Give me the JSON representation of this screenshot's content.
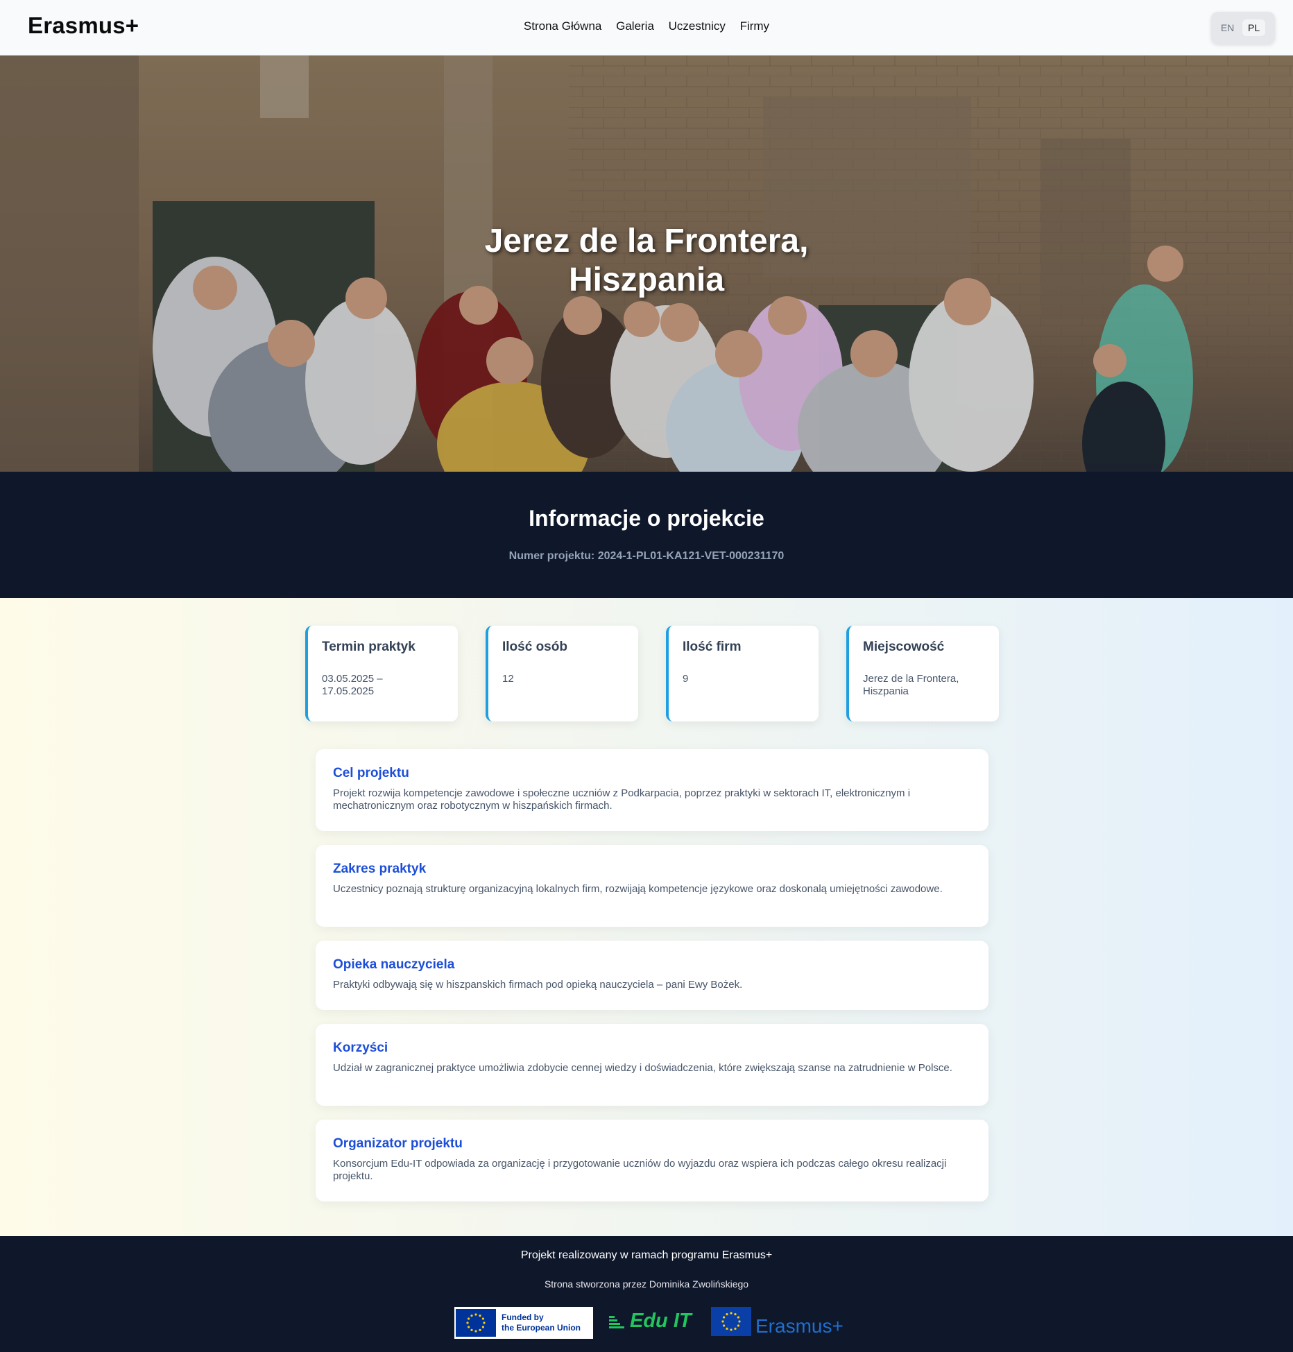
{
  "header": {
    "brand": "Erasmus+",
    "nav": [
      "Strona Główna",
      "Galeria",
      "Uczestnicy",
      "Firmy"
    ],
    "lang_en": "EN",
    "lang_pl": "PL"
  },
  "hero": {
    "title_line1": "Jerez de la Frontera,",
    "title_line2": "Hiszpania"
  },
  "info": {
    "title": "Informacje o projekcie",
    "project_number": "Numer projektu: 2024-1-PL01-KA121-VET-000231170"
  },
  "stats": [
    {
      "title": "Termin praktyk",
      "value": "03.05.2025 – 17.05.2025"
    },
    {
      "title": "Ilość osób",
      "value": "12"
    },
    {
      "title": "Ilość firm",
      "value": "9"
    },
    {
      "title": "Miejscowość",
      "value": "Jerez de la Frontera, Hiszpania"
    }
  ],
  "sections": [
    {
      "title": "Cel projektu",
      "text": "Projekt rozwija kompetencje zawodowe i społeczne uczniów z Podkarpacia, poprzez praktyki w sektorach IT, elektronicznym i mechatronicznym oraz robotycznym w hiszpańskich firmach."
    },
    {
      "title": "Zakres praktyk",
      "text": "Uczestnicy poznają strukturę organizacyjną lokalnych firm, rozwijają kompetencje językowe oraz doskonalą umiejętności zawodowe."
    },
    {
      "title": "Opieka nauczyciela",
      "text": "Praktyki odbywają się w hiszpanskich firmach pod opieką nauczyciela – pani Ewy Bożek."
    },
    {
      "title": "Korzyści",
      "text": "Udział w zagranicznej praktyce umożliwia zdobycie cennej wiedzy i doświadczenia, które zwiększają szanse na zatrudnienie w Polsce."
    },
    {
      "title": "Organizator projektu",
      "text": "Konsorcjum Edu-IT odpowiada za organizację i przygotowanie uczniów do wyjazdu oraz wspiera ich podczas całego okresu realizacji projektu."
    }
  ],
  "footer": {
    "line1": "Projekt realizowany w ramach programu Erasmus+",
    "line2": "Strona stworzona przez Dominika Zwolińskiego",
    "eu_logo_line1": "Funded by",
    "eu_logo_line2": "the European Union",
    "eduit_logo": "Edu IT",
    "erasmus_logo": "Erasmus+"
  }
}
